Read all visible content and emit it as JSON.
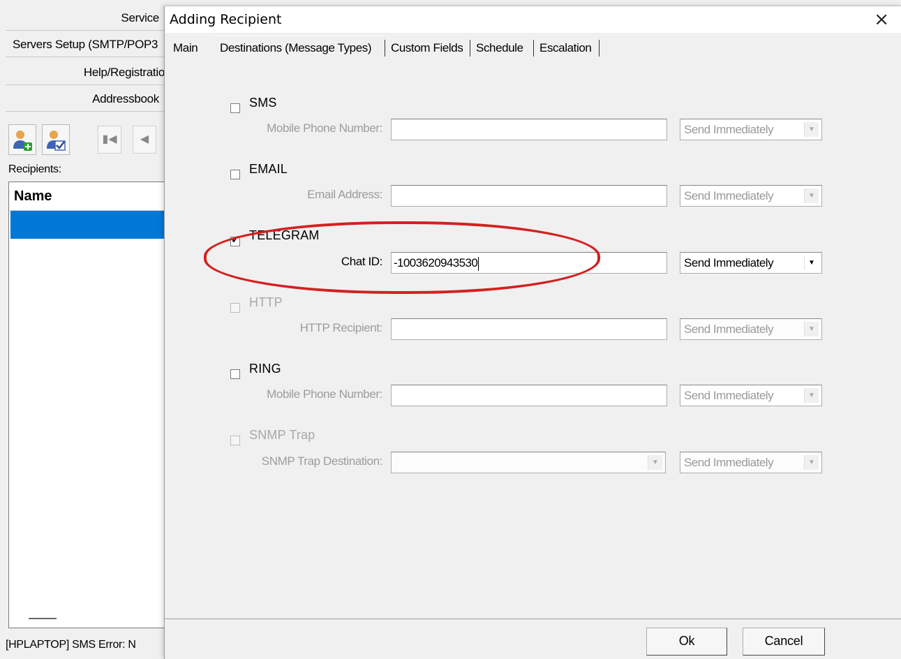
{
  "background_window": {
    "nav": {
      "service": "Service",
      "servers_setup": "Servers Setup (SMTP/POP3",
      "help_registration": "Help/Registratio",
      "addressbook": "Addressbook"
    },
    "toolbar": {
      "add_recipient_icon": "add-user-icon",
      "edit_recipient_icon": "edit-user-icon",
      "first_icon": "first-record-icon",
      "prev_icon": "prev-record-icon"
    },
    "recipients_label": "Recipients:",
    "list": {
      "column_header": "Name"
    },
    "status_text": "[HPLAPTOP]  SMS Error: N"
  },
  "dialog": {
    "title": "Adding Recipient",
    "close_glyph": "×",
    "tabs": [
      {
        "label": "Main",
        "active": false
      },
      {
        "label": "Destinations (Message Types)",
        "active": true
      },
      {
        "label": "Custom Fields",
        "active": false
      },
      {
        "label": "Schedule",
        "active": false
      },
      {
        "label": "Escalation",
        "active": false
      }
    ],
    "destinations": {
      "sms": {
        "label": "SMS",
        "checked": false,
        "enabled": true,
        "field_label": "Mobile Phone Number:",
        "value": "",
        "schedule": "Send Immediately"
      },
      "email": {
        "label": "EMAIL",
        "checked": false,
        "enabled": true,
        "field_label": "Email Address:",
        "value": "",
        "schedule": "Send Immediately"
      },
      "telegram": {
        "label": "TELEGRAM",
        "checked": true,
        "enabled": true,
        "field_label": "Chat ID:",
        "value": "-1003620943530",
        "schedule": "Send Immediately"
      },
      "http": {
        "label": "HTTP",
        "checked": false,
        "enabled": false,
        "field_label": "HTTP Recipient:",
        "value": "",
        "schedule": "Send Immediately"
      },
      "ring": {
        "label": "RING",
        "checked": false,
        "enabled": true,
        "field_label": "Mobile Phone Number:",
        "value": "",
        "schedule": "Send Immediately"
      },
      "snmp": {
        "label": "SNMP Trap",
        "checked": false,
        "enabled": false,
        "field_label": "SNMP Trap Destination:",
        "value": "",
        "schedule": "Send Immediately"
      }
    },
    "checkmark_glyph": "✓",
    "buttons": {
      "ok": "Ok",
      "cancel": "Cancel"
    },
    "colors": {
      "highlight": "#d42020",
      "selection": "#0078d7"
    }
  }
}
